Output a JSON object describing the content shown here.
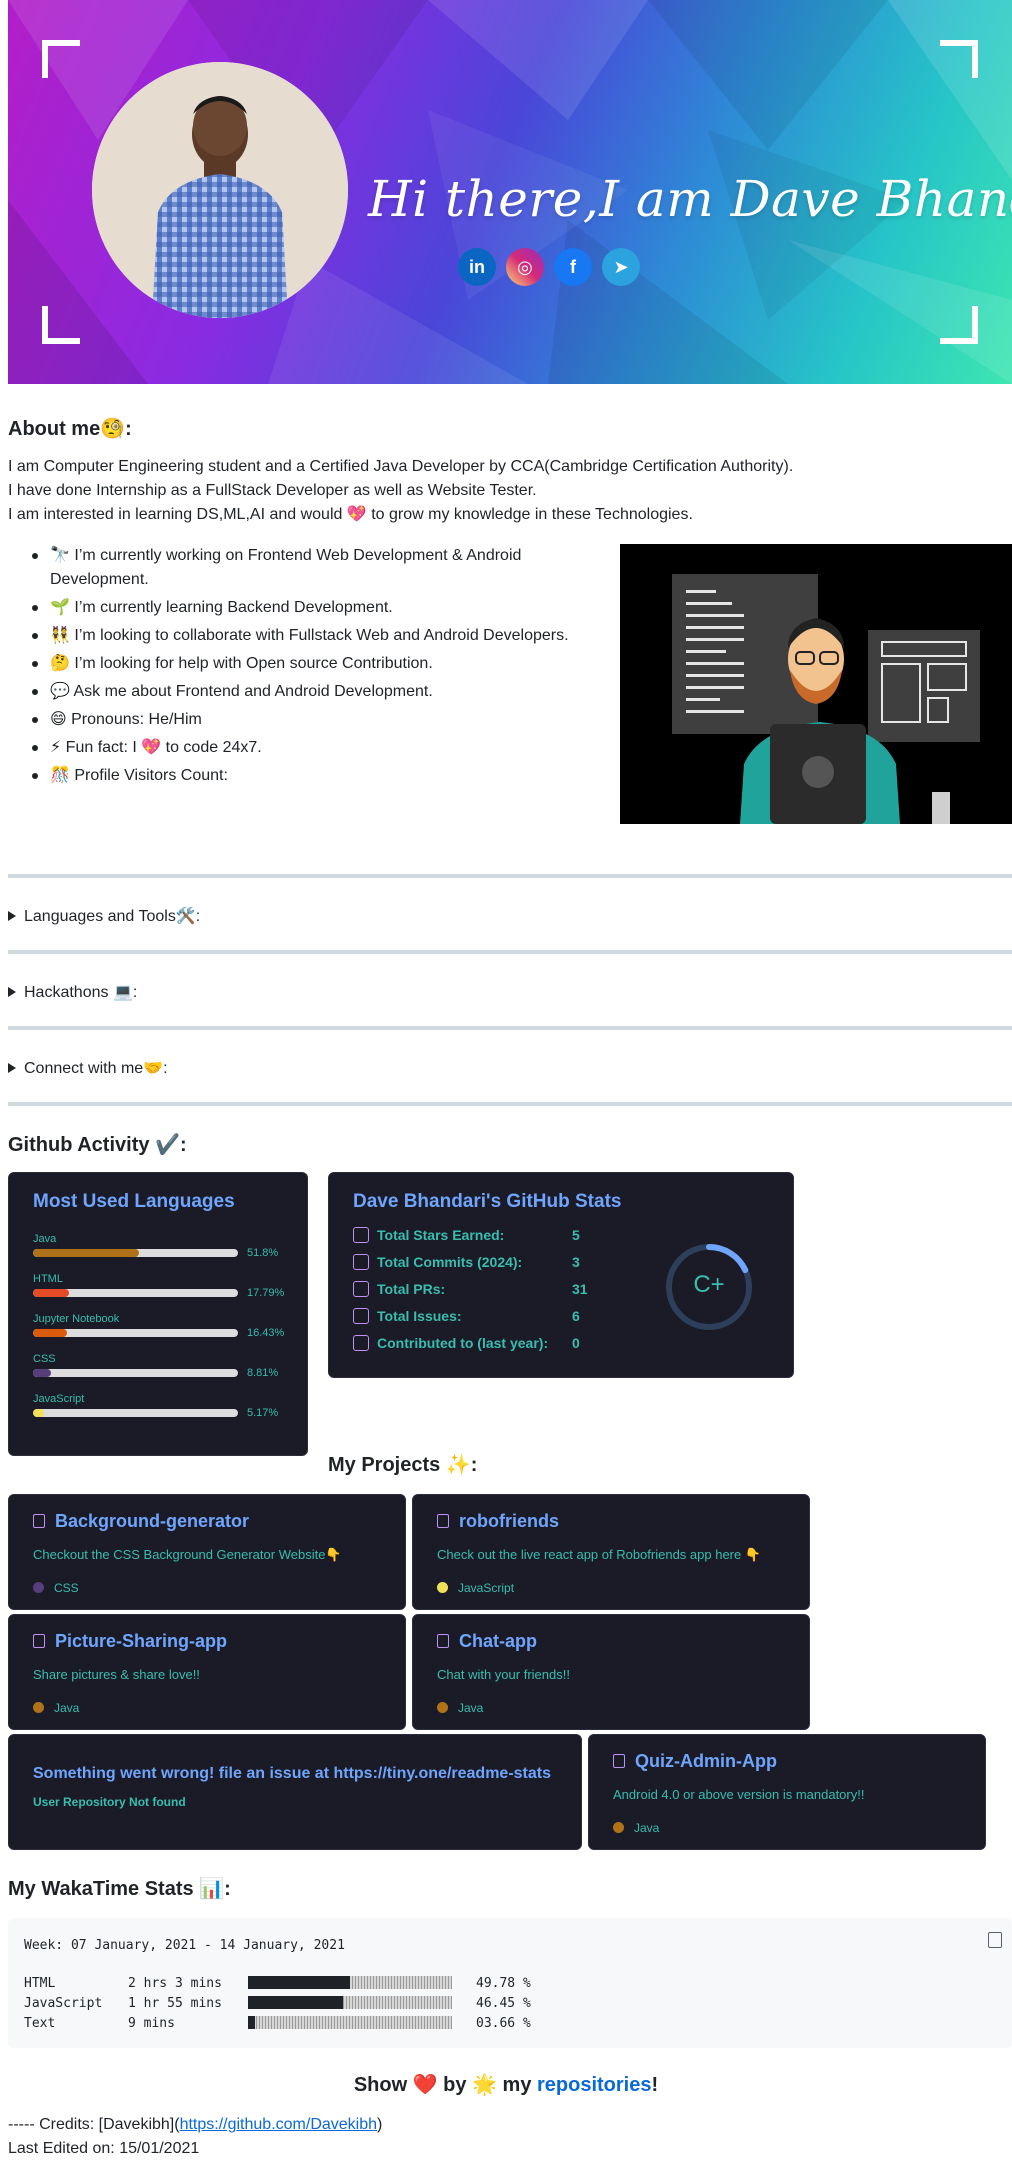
{
  "banner": {
    "headline": "Hi there,I am Dave Bhandari",
    "social": [
      "linkedin-icon",
      "instagram-icon",
      "facebook-icon",
      "telegram-icon"
    ],
    "colors": {
      "left": "#b21ec8",
      "right": "#3de6b0"
    }
  },
  "about": {
    "heading": "About me🧐:",
    "lines": [
      "I am Computer Engineering student and a Certified Java Developer by CCA(Cambridge Certification Authority).",
      "I have done Internship as a FullStack Developer as well as Website Tester.",
      "I am interested in learning DS,ML,AI and would 💖 to grow my knowledge in these Technologies."
    ],
    "bullets": [
      "🔭 I’m currently working on Frontend Web Development & Android Development.",
      "🌱 I’m currently learning Backend Development.",
      "👯 I’m looking to collaborate with Fullstack Web and Android Developers.",
      "🤔 I’m looking for help with Open source Contribution.",
      "💬 Ask me about Frontend and Android Development.",
      "😄 Pronouns: He/Him",
      "⚡ Fun fact: I 💖 to code 24x7.",
      "🎊 Profile Visitors Count:"
    ]
  },
  "sections": {
    "languages": "Languages and Tools🛠️:",
    "hackathons": "Hackathons 💻:",
    "connect": "Connect with me🤝:",
    "github_activity": "Github Activity ✔️:",
    "projects": "My Projects ✨:",
    "wakatime": "My WakaTime Stats 📊:"
  },
  "most_used": {
    "title": "Most Used Languages",
    "langs": [
      {
        "name": "Java",
        "pct": "51.8%",
        "frac": 0.518,
        "color": "#b07219"
      },
      {
        "name": "HTML",
        "pct": "17.79%",
        "frac": 0.1779,
        "color": "#e34c26"
      },
      {
        "name": "Jupyter Notebook",
        "pct": "16.43%",
        "frac": 0.1643,
        "color": "#da5b0b"
      },
      {
        "name": "CSS",
        "pct": "8.81%",
        "frac": 0.0881,
        "color": "#563d7c"
      },
      {
        "name": "JavaScript",
        "pct": "5.17%",
        "frac": 0.0517,
        "color": "#f1e05a"
      }
    ]
  },
  "stats": {
    "title": "Dave Bhandari's GitHub Stats",
    "rows": [
      {
        "icon": "star-icon",
        "label": "Total Stars Earned:",
        "value": "5"
      },
      {
        "icon": "history-icon",
        "label": "Total Commits (2024):",
        "value": "3"
      },
      {
        "icon": "pull-request-icon",
        "label": "Total PRs:",
        "value": "31"
      },
      {
        "icon": "issue-icon",
        "label": "Total Issues:",
        "value": "6"
      },
      {
        "icon": "repo-icon",
        "label": "Contributed to (last year):",
        "value": "0"
      }
    ],
    "rank": "C+"
  },
  "repos": [
    {
      "name": "Background-generator",
      "desc": "Checkout the CSS Background Generator Website👇",
      "lang": "CSS",
      "color": "#563d7c"
    },
    {
      "name": "robofriends",
      "desc": "Check out the live react app of Robofriends app here 👇",
      "lang": "JavaScript",
      "color": "#f1e05a"
    },
    {
      "name": "Picture-Sharing-app",
      "desc": "Share pictures & share love!!",
      "lang": "Java",
      "color": "#b07219"
    },
    {
      "name": "Chat-app",
      "desc": "Chat with your friends!!",
      "lang": "Java",
      "color": "#b07219"
    },
    {
      "name": "Quiz-Admin-App",
      "desc": "Android 4.0 or above version is mandatory!!",
      "lang": "Java",
      "color": "#b07219"
    }
  ],
  "error_card": {
    "title": "Something went wrong! file an issue at https://tiny.one/readme-stats",
    "sub": "User Repository Not found"
  },
  "waka": {
    "week": "Week: 07 January, 2021 - 14 January, 2021",
    "rows": [
      {
        "lang": "HTML",
        "time": "2 hrs 3 mins",
        "frac": 0.4978,
        "pct": "49.78 %"
      },
      {
        "lang": "JavaScript",
        "time": "1 hr 55 mins",
        "frac": 0.4645,
        "pct": "46.45 %"
      },
      {
        "lang": "Text",
        "time": "9 mins",
        "frac": 0.0366,
        "pct": "03.66 %"
      }
    ]
  },
  "footer": {
    "show_pre": "Show ❤️ by 🌟 my ",
    "show_link": "repositories",
    "show_post": "!",
    "credits_pre": "----- Credits: [Davekibh](",
    "credits_link": "https://github.com/Davekibh",
    "credits_post": ")",
    "last_edited": "Last Edited on: 15/01/2021"
  }
}
